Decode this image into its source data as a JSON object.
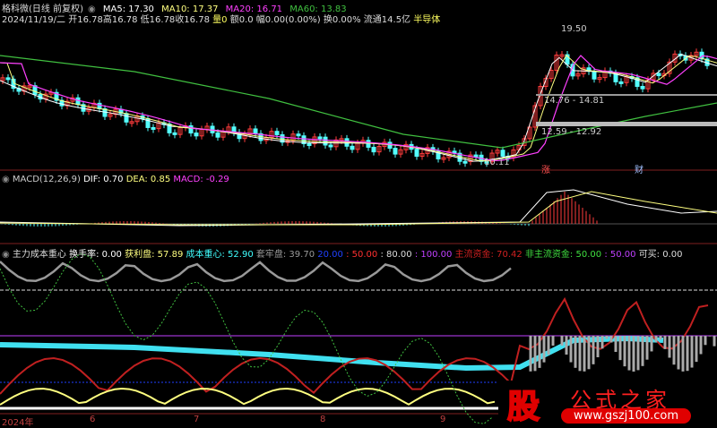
{
  "header": {
    "title": "格科微(日线 前复权)",
    "ma5": "MA5: 17.30",
    "ma10": "MA10: 17.37",
    "ma20": "MA20: 16.71",
    "ma60": "MA60: 13.83",
    "date": "2024/11/19/二",
    "open": "开16.78",
    "high": "高16.78",
    "low": "低16.78",
    "close": "收16.78",
    "vol": "量0",
    "amount": "额0.0",
    "change": "幅0.00(0.00%)",
    "turnover": "换0.00%",
    "float": "流通14.5亿",
    "sector": "半导体"
  },
  "price_chart": {
    "high_label": "19.50",
    "low_label": "10.11",
    "zone1": "14.76 - 14.81",
    "zone2": "12.59 - 12.92",
    "marker_zhang": "涨",
    "marker_cai": "财"
  },
  "macd": {
    "name": "MACD(12,26,9)",
    "dif": "DIF: 0.70",
    "dea": "DEA: 0.85",
    "macd": "MACD: -0.29"
  },
  "indicator": {
    "name": "主力成本重心",
    "turnover": "换手率: 0.00",
    "profit": "获利盘: 57.89",
    "cost": "成本重心: 52.90",
    "trapped": "套牢盘: 39.70",
    "l20": "20.00",
    "l50": ": 50.00",
    "l80": ": 80.00",
    "l100": ": 100.00",
    "main_fund": "主流资金: 70.42",
    "non_main_fund": "非主流资金: 50.00",
    "n50": ": 50.00",
    "buy": "可买: 0.00"
  },
  "xaxis": [
    "2024年",
    "6",
    "7",
    "8",
    "9"
  ],
  "watermark": {
    "logo_char": "股",
    "site_name": "公式之家",
    "url": "www.gszj100.com"
  },
  "colors": {
    "up": "#ff3c3c",
    "down": "#54ffff",
    "ma5": "#ffffff",
    "ma10": "#ffff80",
    "ma20": "#ff40ff",
    "ma60": "#40c040"
  }
}
